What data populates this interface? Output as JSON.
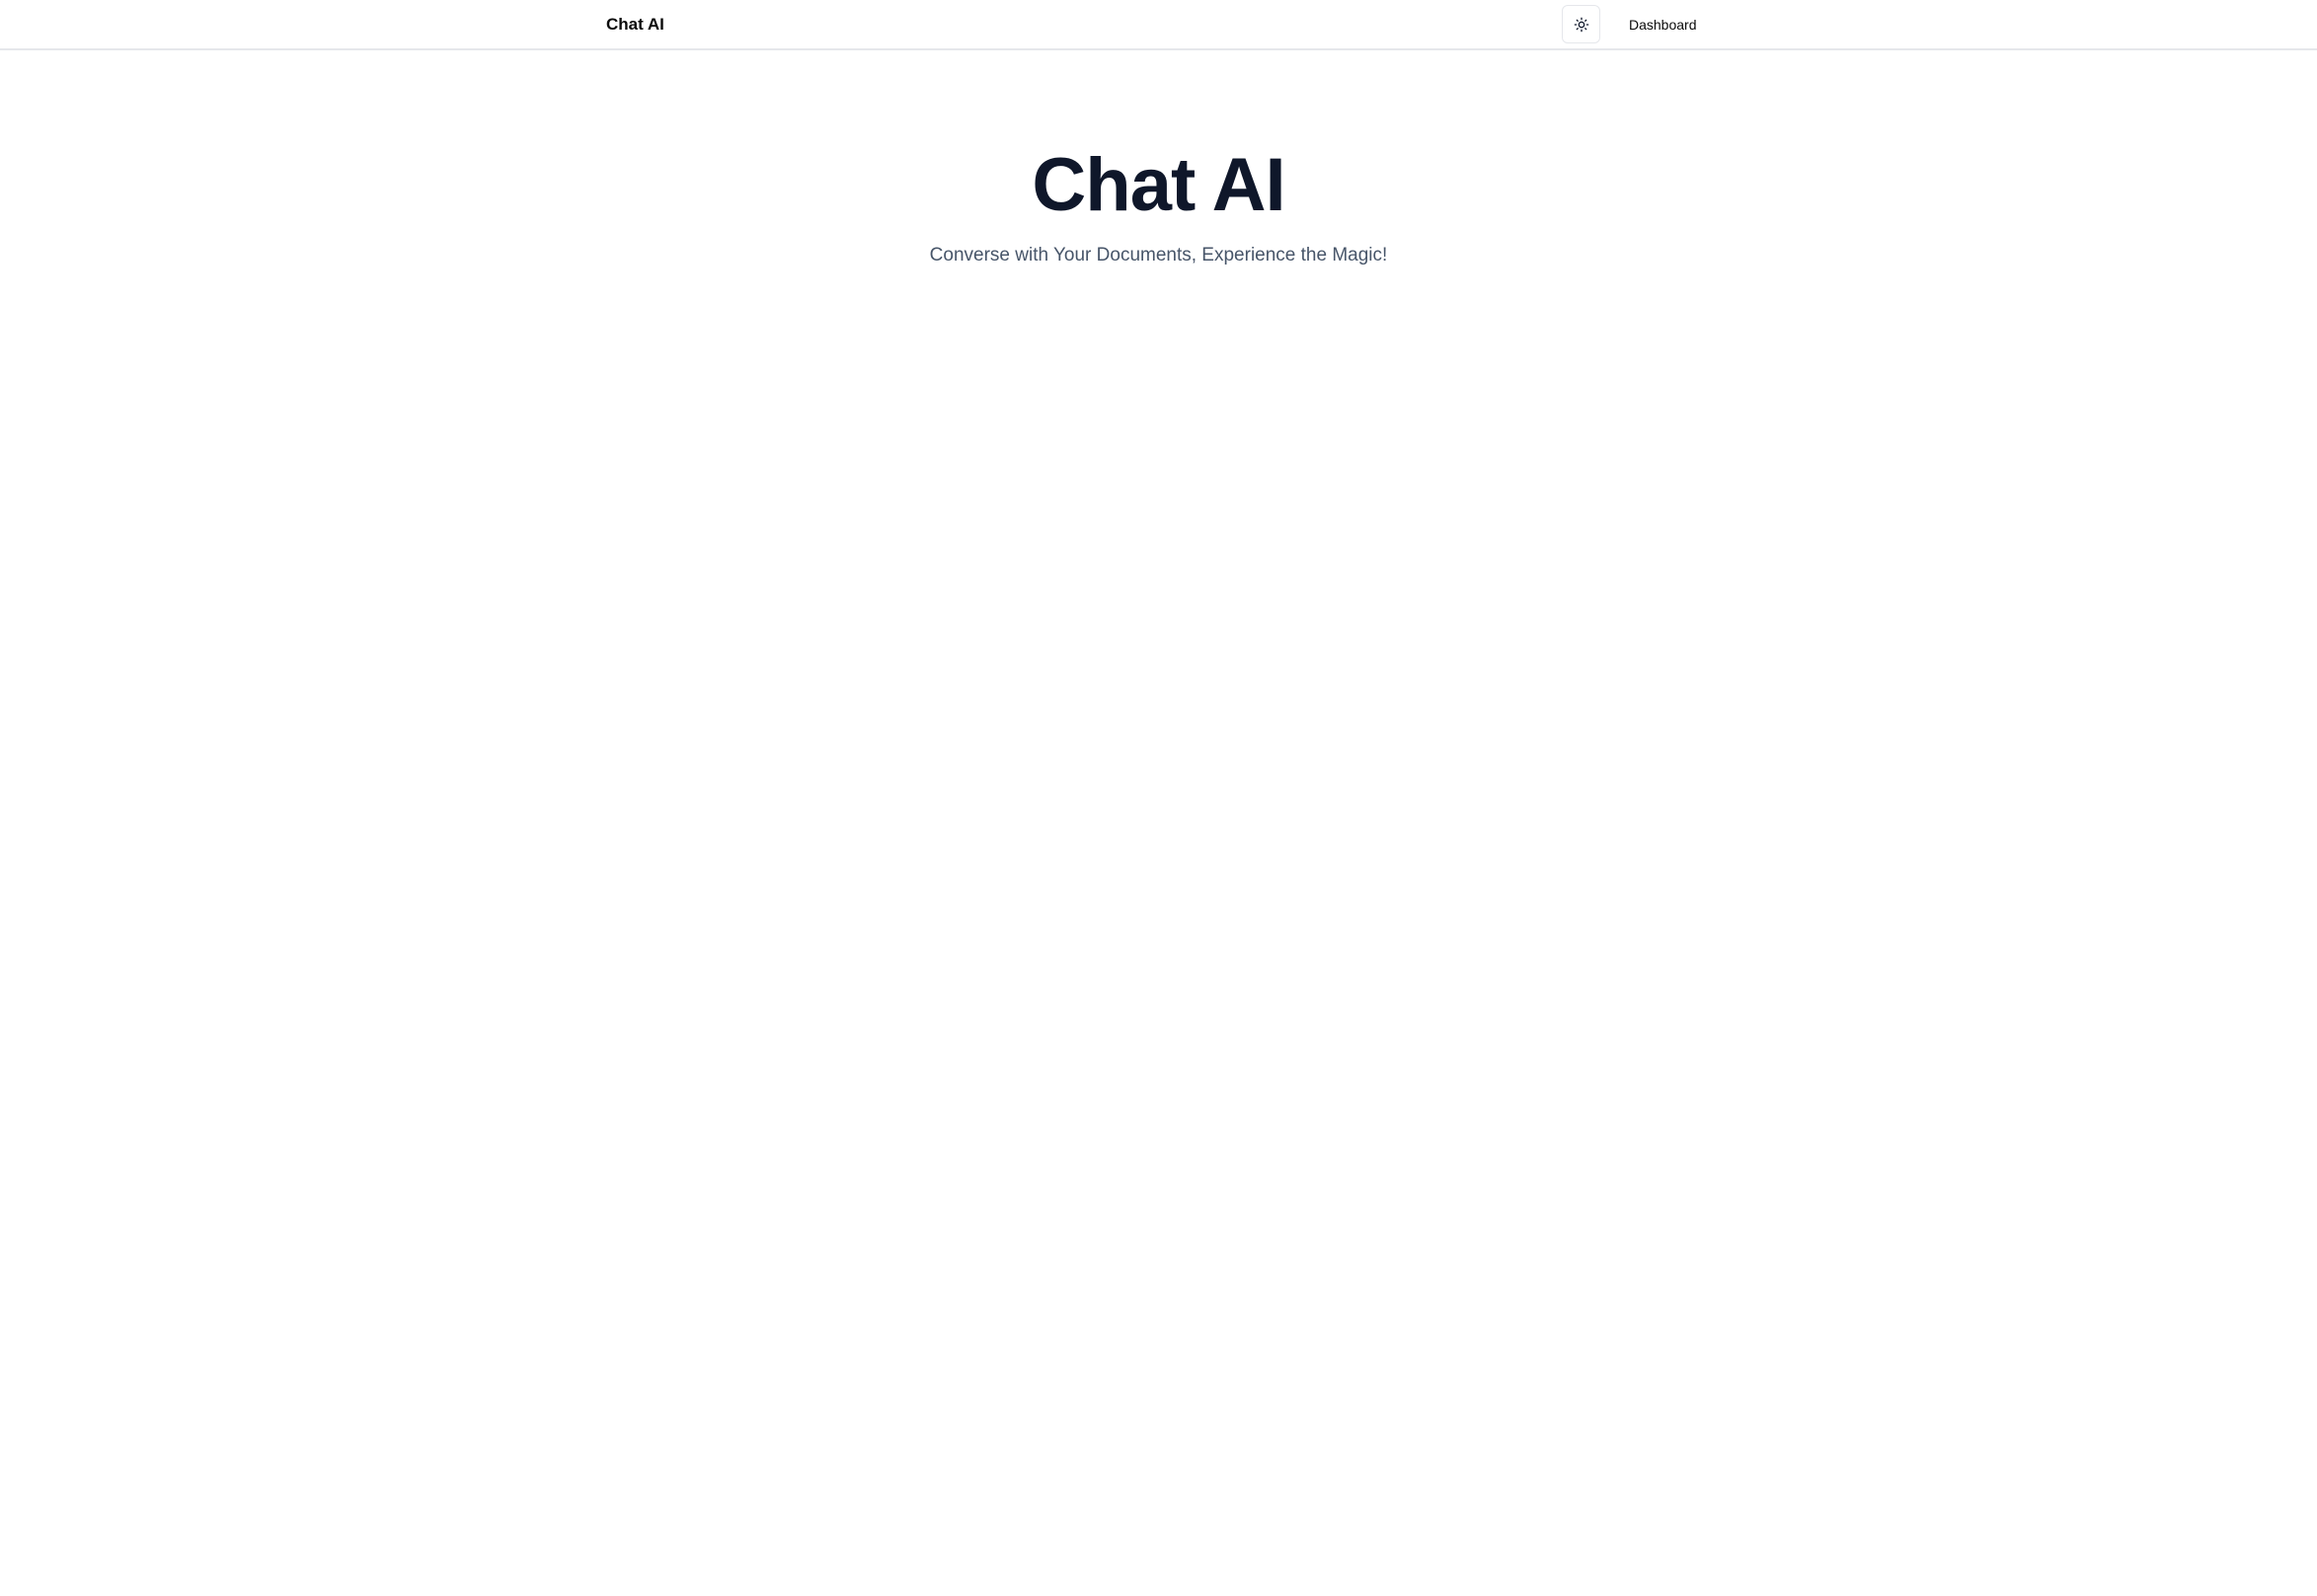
{
  "navbar": {
    "brand": "Chat AI",
    "theme_toggle_icon": "sun-icon",
    "links": [
      {
        "label": "Dashboard"
      }
    ]
  },
  "hero": {
    "title": "Chat AI",
    "subtitle": "Converse with Your Documents, Experience the Magic!"
  },
  "colors": {
    "background": "#ffffff",
    "title": "#0f172a",
    "subtitle": "#475569",
    "border": "#e5e7eb"
  }
}
